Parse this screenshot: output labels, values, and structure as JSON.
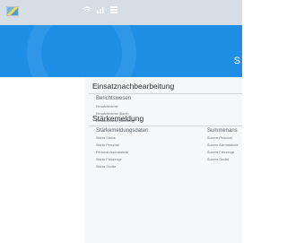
{
  "topbar": {
    "logo_icon": "flag-icon",
    "icons": [
      "wifi-icon",
      "signal-icon",
      "grid-icon"
    ]
  },
  "banner": {
    "title": "S",
    "color": "#1e8fe5"
  },
  "sections": [
    {
      "title": "Einsatznachbearbeitung",
      "columns": [
        {
          "title": "Berichtswesen",
          "items": [
            "Einsatzberichte",
            "Einsatzberichte (Bardt)",
            "Einsatzberichte (Abteilung)"
          ]
        }
      ]
    },
    {
      "title": "Stärkemeldung",
      "columns": [
        {
          "title": "Stärkemeldungsdaten",
          "items": [
            "Stärke Status",
            "Stärke Personal",
            "Personal Alarmstatistik",
            "Stärke Fahrzeuge",
            "Stärke Geräte"
          ]
        },
        {
          "title": "Summenans",
          "items": [
            "Summe Personal",
            "Summe Alarmstatistik",
            "Summe Fahrzeuge",
            "Summe Geräte"
          ]
        }
      ]
    }
  ]
}
